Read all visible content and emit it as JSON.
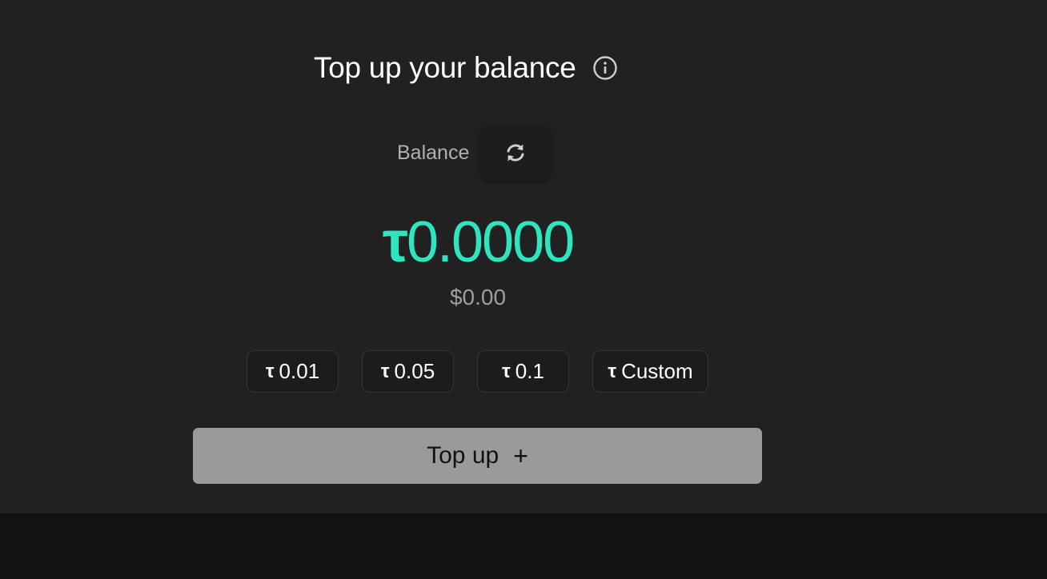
{
  "header": {
    "title": "Top up your balance",
    "info_icon": "info-circle-icon"
  },
  "balance": {
    "label": "Balance",
    "refresh_icon": "refresh-icon",
    "currency_symbol": "τ",
    "amount": "0.0000",
    "usd_value": "$0.00"
  },
  "presets": [
    {
      "symbol": "τ",
      "label": "0.01"
    },
    {
      "symbol": "τ",
      "label": "0.05"
    },
    {
      "symbol": "τ",
      "label": "0.1"
    },
    {
      "symbol": "τ",
      "label": "Custom"
    }
  ],
  "action": {
    "label": "Top up",
    "icon": "+"
  },
  "colors": {
    "accent": "#2ee5c0",
    "panel": "#212121",
    "footer": "#121212",
    "button": "#9a9a9a"
  }
}
